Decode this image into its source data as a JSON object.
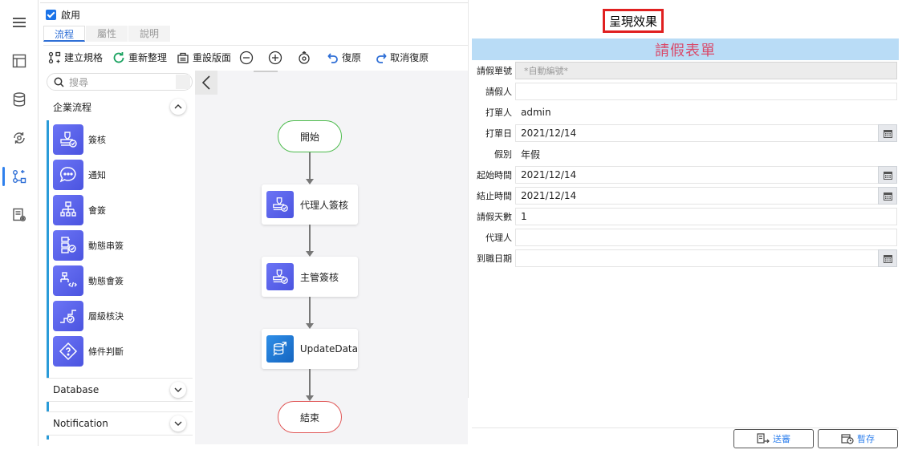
{
  "editor": {
    "enable_label": "啟用",
    "tabs": [
      "流程",
      "屬性",
      "說明"
    ],
    "toolbar": {
      "build_spec": "建立規格",
      "reorganize": "重新整理",
      "reset_layout": "重設版面",
      "undo": "復原",
      "redo": "取消復原"
    },
    "search_placeholder": "搜尋"
  },
  "palette": {
    "group_business": "企業流程",
    "items": [
      "簽核",
      "通知",
      "會簽",
      "動態串簽",
      "動態會簽",
      "層級核決",
      "條件判斷"
    ],
    "group_database": "Database",
    "group_notification": "Notification"
  },
  "flow": {
    "start": "開始",
    "step1": "代理人簽核",
    "step2": "主管簽核",
    "step3": "UpdateData",
    "end": "結束"
  },
  "preview": {
    "title": "呈現效果",
    "form_title": "請假表單",
    "fields": [
      {
        "label": "請假單號",
        "value": "*自動編號*"
      },
      {
        "label": "請假人",
        "value": ""
      },
      {
        "label": "打單人",
        "value": "admin"
      },
      {
        "label": "打單日",
        "value": "2021/12/14"
      },
      {
        "label": "假別",
        "value": "年假"
      },
      {
        "label": "起始時間",
        "value": "2021/12/14"
      },
      {
        "label": "結止時間",
        "value": "2021/12/14"
      },
      {
        "label": "請假天數",
        "value": "1"
      },
      {
        "label": "代理人",
        "value": ""
      },
      {
        "label": "到職日期",
        "value": ""
      }
    ],
    "send_button": "送審",
    "save_button": "暫存"
  }
}
